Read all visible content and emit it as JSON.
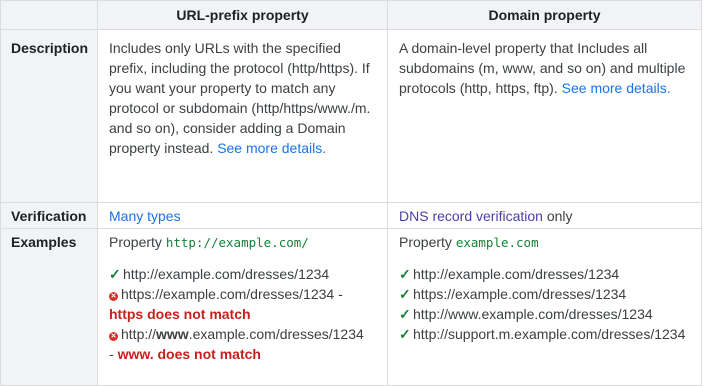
{
  "header": {
    "col1": "",
    "col2": "URL-prefix property",
    "col3": "Domain property"
  },
  "rows": {
    "description": {
      "label": "Description",
      "url_prefix": {
        "text": "Includes only URLs with the specified prefix, including the protocol (http/https). If you want your property to match any protocol or subdomain (http/https/www./m. and so on), consider adding a Domain property instead.",
        "link": "See more details."
      },
      "domain": {
        "text": "A domain-level property that Includes all subdomains (m, www, and so on) and multiple protocols (http, https, ftp).",
        "link": "See more details."
      }
    },
    "verification": {
      "label": "Verification",
      "url_prefix": {
        "link": "Many types"
      },
      "domain": {
        "link": "DNS record verification",
        "suffix": "only"
      }
    },
    "examples": {
      "label": "Examples",
      "url_prefix": {
        "property_label": "Property",
        "property_value": "http://example.com/",
        "items": [
          {
            "status": "match",
            "icon": "check-icon",
            "url": "http://example.com/dresses/1234",
            "sep": "",
            "reason": ""
          },
          {
            "status": "nomatch",
            "icon": "cross-icon",
            "url": "https://example.com/dresses/1234",
            "sep": " -",
            "reason": "https does not match"
          },
          {
            "status": "nomatch",
            "icon": "cross-icon",
            "url_prefix": "http://",
            "url_bold": "www",
            "url_suffix": ".example.com/dresses/1234",
            "sep": "-",
            "reason": "www. does not match"
          }
        ]
      },
      "domain": {
        "property_label": "Property",
        "property_value": "example.com",
        "items": [
          {
            "status": "match",
            "icon": "check-icon",
            "url": "http://example.com/dresses/1234"
          },
          {
            "status": "match",
            "icon": "check-icon",
            "url": "https://example.com/dresses/1234"
          },
          {
            "status": "match",
            "icon": "check-icon",
            "url": "http://www.example.com/dresses/1234"
          },
          {
            "status": "match",
            "icon": "check-icon",
            "url": "http://support.m.example.com/dresses/1234"
          }
        ]
      }
    }
  },
  "symbols": {
    "check": "✓",
    "cross": "✕"
  },
  "colors": {
    "link": "#1a73e8",
    "visited_link": "#4a3fa8",
    "code": "#188038",
    "fail": "#c5221f",
    "header_bg": "#f1f3f4",
    "border": "#dadce0"
  }
}
